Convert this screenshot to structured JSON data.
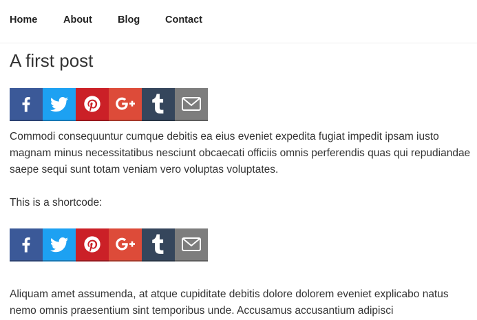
{
  "nav": {
    "items": [
      "Home",
      "About",
      "Blog",
      "Contact"
    ]
  },
  "post": {
    "title": "A first post",
    "paragraph_1": "Commodi consequuntur cumque debitis ea eius eveniet expedita fugiat impedit ipsam iusto magnam minus necessitatibus nesciunt obcaecati officiis omnis perferendis quas qui repudiandae saepe sequi sunt totam veniam vero voluptas voluptates.",
    "shortcode_text": "This is a shortcode:",
    "paragraph_2": "Aliquam amet assumenda, at atque cupiditate debitis dolore dolorem eveniet explicabo natus nemo omnis praesentium sint temporibus unde. Accusamus accusantium adipisci"
  },
  "share_buttons": [
    {
      "icon": "facebook-icon",
      "color": "#3b5998"
    },
    {
      "icon": "twitter-icon",
      "color": "#1da1f2"
    },
    {
      "icon": "pinterest-icon",
      "color": "#cb2027"
    },
    {
      "icon": "google-plus-icon",
      "color": "#dd4b39"
    },
    {
      "icon": "tumblr-icon",
      "color": "#35465c"
    },
    {
      "icon": "email-icon",
      "color": "#7d7d7d"
    }
  ]
}
